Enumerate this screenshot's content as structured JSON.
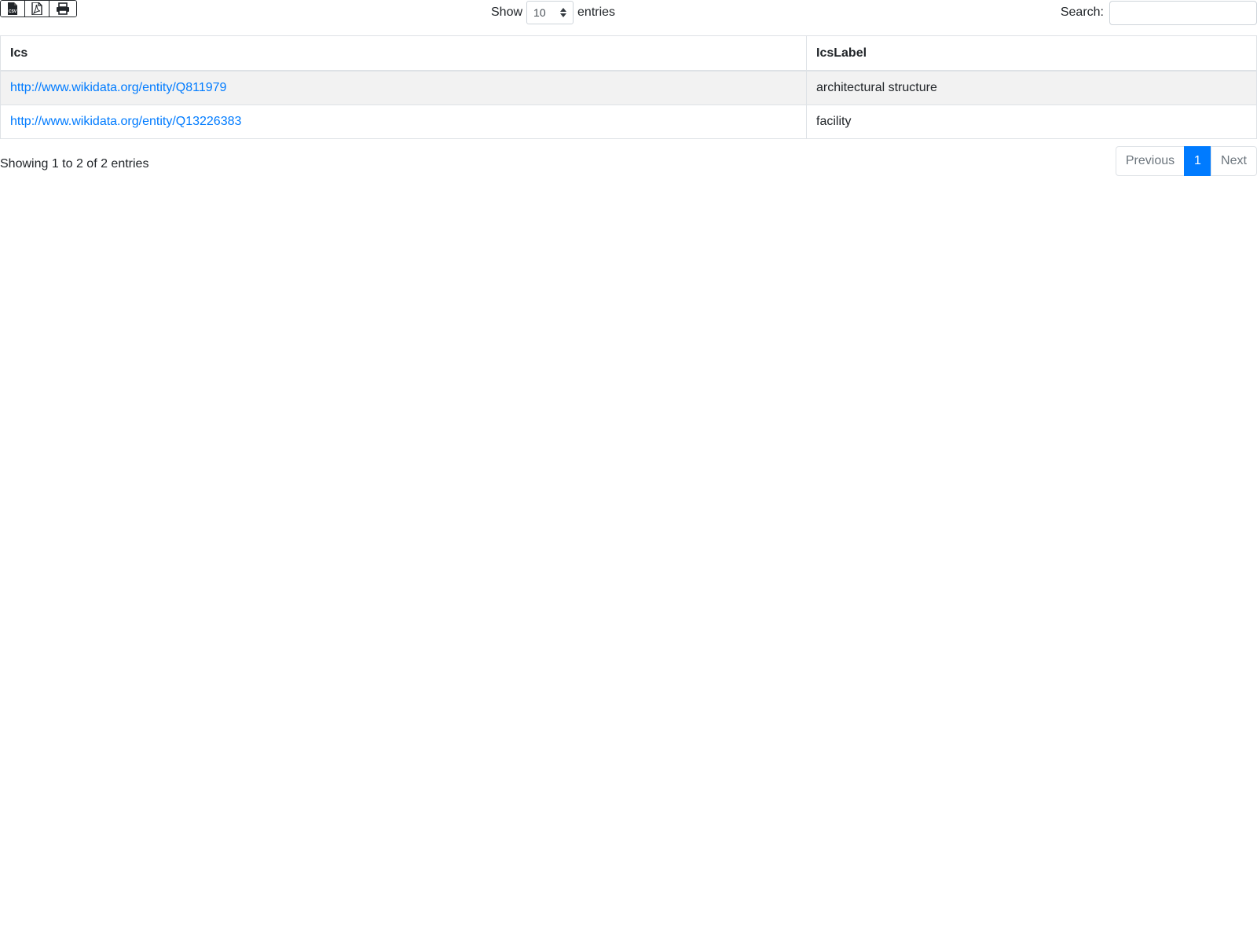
{
  "toolbar": {
    "export_buttons": [
      {
        "icon": "csv-file-icon"
      },
      {
        "icon": "pdf-file-icon"
      },
      {
        "icon": "print-icon"
      }
    ],
    "length_prefix": "Show",
    "length_value": "10",
    "length_suffix": "entries",
    "search_label": "Search:",
    "search_value": ""
  },
  "table": {
    "headers": [
      "Ics",
      "IcsLabel"
    ],
    "rows": [
      {
        "ics": "http://www.wikidata.org/entity/Q811979",
        "label": "architectural structure"
      },
      {
        "ics": "http://www.wikidata.org/entity/Q13226383",
        "label": "facility"
      }
    ]
  },
  "footer": {
    "info": "Showing 1 to 2 of 2 entries",
    "previous": "Previous",
    "current_page": "1",
    "next": "Next"
  },
  "colors": {
    "accent": "#007bff",
    "stripe": "#f2f2f2",
    "border": "#dee2e6"
  }
}
